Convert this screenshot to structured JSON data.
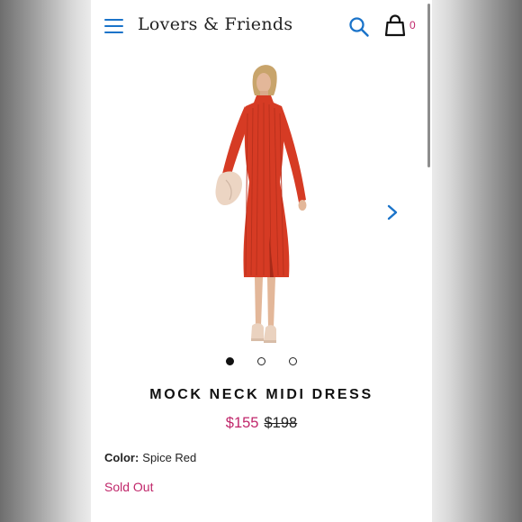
{
  "header": {
    "brand": "Lovers & Friends",
    "cart_count": "0",
    "icons": [
      "menu-icon",
      "search-icon",
      "shopping-bag-icon"
    ]
  },
  "gallery": {
    "image": "model in red ribbed mock neck midi dress",
    "image_count": 3,
    "active_index": 0,
    "next_icon": "chevron-right-icon"
  },
  "product": {
    "title": "MOCK NECK MIDI DRESS",
    "sale_price": "$155",
    "original_price": "$198",
    "color_label": "Color:",
    "color_value": "Spice Red",
    "availability": "Sold Out"
  },
  "colors": {
    "accent_blue": "#1a73c9",
    "price_pink": "#c0266a",
    "dress_red": "#d63b24"
  }
}
